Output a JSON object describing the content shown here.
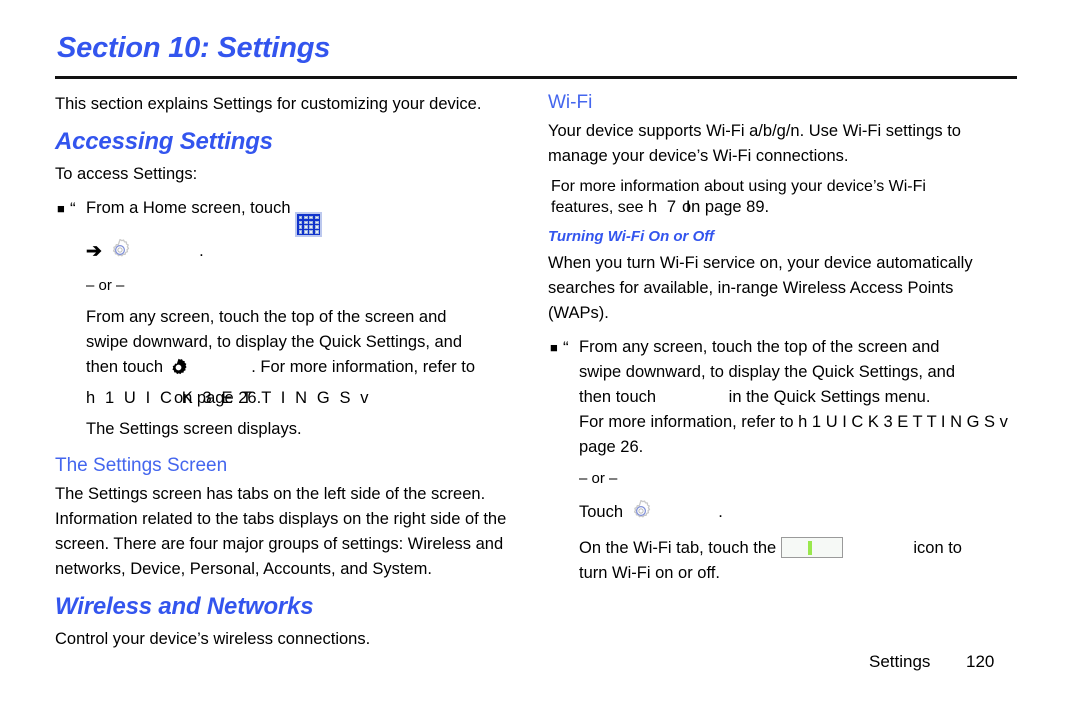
{
  "document": {
    "section_title": "Section 10: Settings",
    "footer_label": "Settings",
    "footer_page": "120"
  },
  "colors": {
    "heading_blue": "#3355ee",
    "subheading_blue": "#4466ee",
    "apps_icon_blue": "#1133cc",
    "toggle_green": "#9ae84e",
    "rule_black": "#121212"
  },
  "left_column": {
    "intro": "This section explains Settings for customizing your device.",
    "accessing_settings": {
      "heading": "Accessing Settings",
      "lead_in": "To access Settings:",
      "bullet": {
        "marker": "■",
        "quote": "“",
        "text_before_icon": "From a Home screen, touch",
        "apps_icon": "apps-grid-icon",
        "arrow": "➔",
        "gear_icon": "settings-gear-icon",
        "trailing_period": ".",
        "or_separator": "– or –",
        "alt_line_1": "From any screen, touch the top of the screen and",
        "alt_line_2": "swipe downward, to display the Quick Settings, and",
        "alt_line_3_before_icon": "then touch",
        "alt_line_3_gear": "settings-gear-solid-icon",
        "alt_line_3_after_icon": ". For more information, refer to",
        "overlap_under": "h 1 U I C K   3 E T T I N G S v",
        "overlap_over": "on page 26.",
        "result": "The Settings screen displays."
      }
    },
    "settings_screen": {
      "heading": "The Settings Screen",
      "paragraph": "The Settings screen has tabs on the left side of the screen. Information related to the tabs displays on the right side of the screen. There are four major groups of settings: Wireless and networks, Device, Personal, Accounts, and System."
    },
    "wireless_networks": {
      "heading": "Wireless and Networks",
      "paragraph": "Control your device’s wireless connections."
    }
  },
  "right_column": {
    "wifi": {
      "heading": "Wi-Fi",
      "paragraph_1": "Your device supports Wi-Fi a/b/g/n. Use Wi-Fi settings to manage your device’s Wi-Fi connections.",
      "paragraph_2_line_1": "For more information about using your device’s Wi-Fi",
      "paragraph_2_line_2_prefix": "features, see",
      "paragraph_2_overlap_under": "h 7 I",
      "paragraph_2_overlap_over": "on page 89."
    },
    "turning_wifi": {
      "heading": "Turning Wi-Fi On or Off",
      "paragraph": "When you turn Wi-Fi service on, your device automatically searches for available, in-range Wireless Access Points (WAPs).",
      "bullet": {
        "marker": "■",
        "quote": "“",
        "line_1": "From any screen, touch the top of the screen and",
        "line_2": "swipe downward, to display the Quick Settings, and",
        "line_3_before": "then touch",
        "line_3_after": "in the Quick Settings menu.",
        "line_4_prefix": "For more information, refer to",
        "line_4_overlap_under": "h 1 U I C K   3 E T T I N G S v",
        "line_4_clipped": true,
        "line_5": "page 26.",
        "or_separator": "– or –",
        "touch_label": "Touch",
        "touch_gear_icon": "settings-gear-icon",
        "touch_period": ".",
        "toggle_line_before": "On the Wi-Fi tab, touch the",
        "toggle_icon": "wifi-toggle-switch",
        "toggle_line_after": "icon to",
        "toggle_line_2": "turn Wi-Fi on or off."
      }
    }
  }
}
